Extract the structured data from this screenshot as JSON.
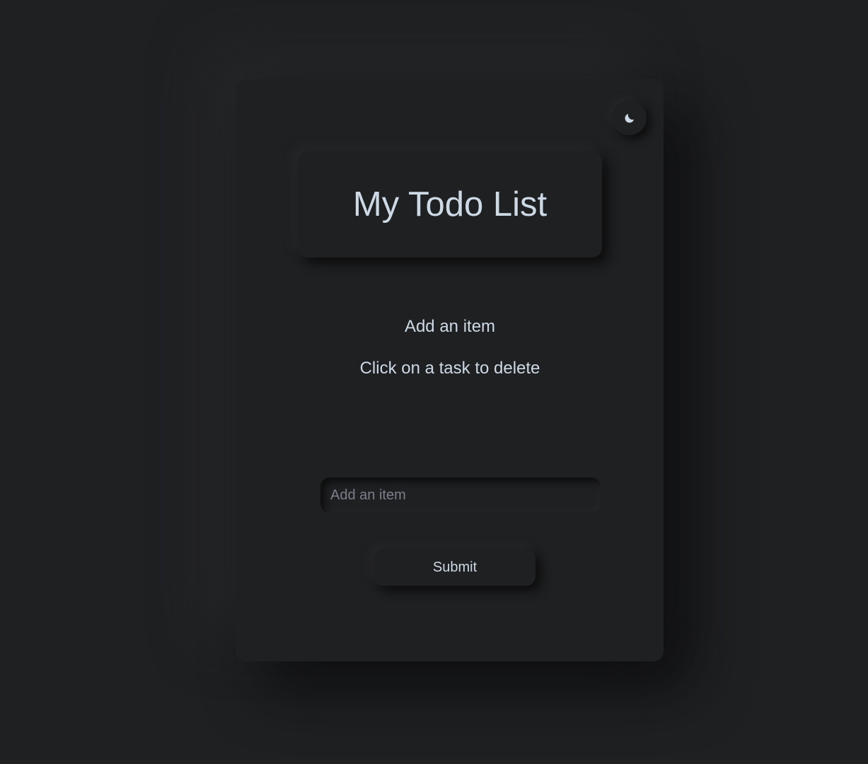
{
  "header": {
    "title": "My Todo List",
    "theme_toggle_icon": "moon-icon"
  },
  "info": {
    "add_text": "Add an item",
    "delete_text": "Click on a task to delete"
  },
  "todo_items": [],
  "form": {
    "input_placeholder": "Add an item",
    "input_value": "",
    "submit_label": "Submit"
  },
  "colors": {
    "background": "#1f2022",
    "text": "#cdd9e5",
    "placeholder": "#7b8088"
  }
}
